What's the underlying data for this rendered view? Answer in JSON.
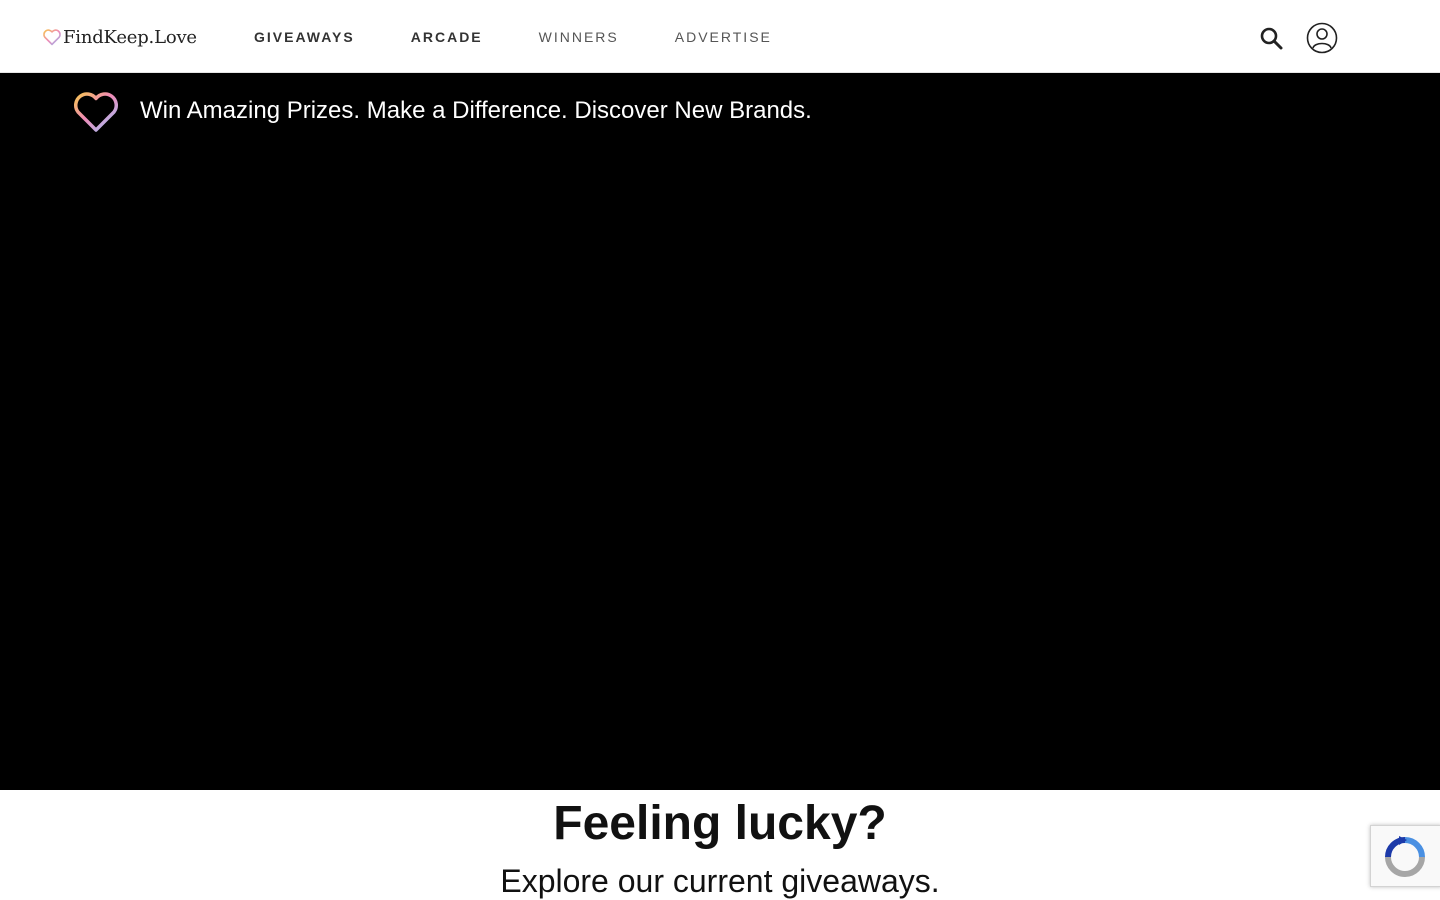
{
  "header": {
    "logo_text": "FindKeep.Love",
    "nav": [
      {
        "label": "GIVEAWAYS"
      },
      {
        "label": "ARCADE"
      },
      {
        "label": "WINNERS"
      },
      {
        "label": "ADVERTISE"
      }
    ],
    "icons": {
      "search": "search-icon",
      "account": "user-account-icon"
    }
  },
  "hero": {
    "tagline": "Win Amazing Prizes. Make a Difference. Discover New Brands.",
    "background_color": "#000000"
  },
  "section": {
    "title": "Feeling lucky?",
    "subtitle": "Explore our current giveaways."
  },
  "recaptcha": {
    "icon": "recaptcha-icon"
  }
}
